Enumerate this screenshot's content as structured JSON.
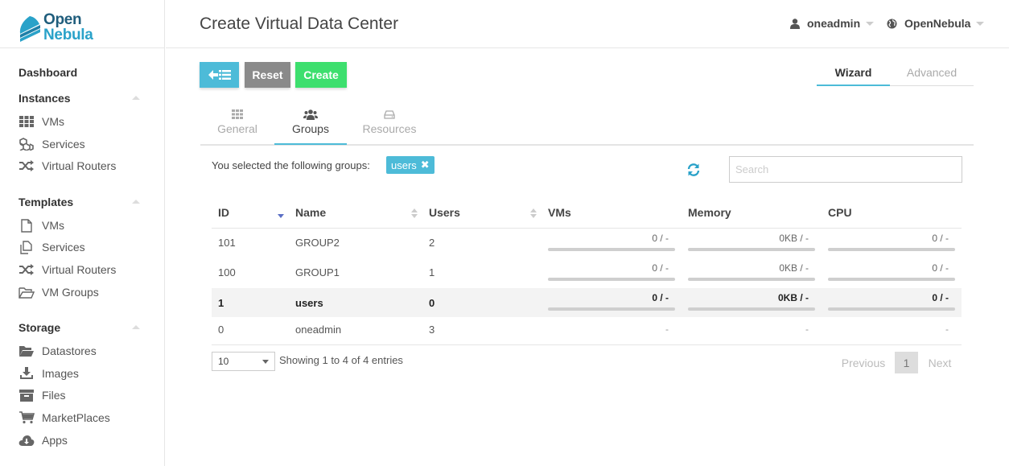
{
  "brand": {
    "line1": "Open",
    "line2": "Nebula"
  },
  "sidebar": {
    "dashboard": "Dashboard",
    "instances": {
      "title": "Instances",
      "items": [
        {
          "label": "VMs",
          "icon": "th-icon"
        },
        {
          "label": "Services",
          "icon": "cubes-icon"
        },
        {
          "label": "Virtual Routers",
          "icon": "random-icon"
        }
      ]
    },
    "templates": {
      "title": "Templates",
      "items": [
        {
          "label": "VMs",
          "icon": "file-icon"
        },
        {
          "label": "Services",
          "icon": "files-icon"
        },
        {
          "label": "Virtual Routers",
          "icon": "random-icon"
        },
        {
          "label": "VM Groups",
          "icon": "folder-open-icon"
        }
      ]
    },
    "storage": {
      "title": "Storage",
      "items": [
        {
          "label": "Datastores",
          "icon": "folder-open-icon"
        },
        {
          "label": "Images",
          "icon": "download-icon"
        },
        {
          "label": "Files",
          "icon": "archive-icon"
        },
        {
          "label": "MarketPlaces",
          "icon": "shopping-cart-icon"
        },
        {
          "label": "Apps",
          "icon": "cloud-download-icon"
        }
      ]
    }
  },
  "header": {
    "title": "Create Virtual Data Center",
    "user": "oneadmin",
    "zone": "OpenNebula"
  },
  "toolbar": {
    "reset_label": "Reset",
    "create_label": "Create"
  },
  "modes": {
    "wizard": "Wizard",
    "advanced": "Advanced"
  },
  "wizard_tabs": {
    "general": "General",
    "groups": "Groups",
    "resources": "Resources"
  },
  "groups": {
    "selected_text": "You selected the following groups:",
    "selected_tag": "users",
    "search_placeholder": "Search",
    "columns": {
      "id": "ID",
      "name": "Name",
      "users": "Users",
      "vms": "VMs",
      "memory": "Memory",
      "cpu": "CPU"
    },
    "rows": [
      {
        "id": "101",
        "name": "GROUP2",
        "users": "2",
        "vms": "0 / -",
        "memory": "0KB / -",
        "cpu": "0 / -"
      },
      {
        "id": "100",
        "name": "GROUP1",
        "users": "1",
        "vms": "0 / -",
        "memory": "0KB / -",
        "cpu": "0 / -"
      },
      {
        "id": "1",
        "name": "users",
        "users": "0",
        "vms": "0 / -",
        "memory": "0KB / -",
        "cpu": "0 / -"
      },
      {
        "id": "0",
        "name": "oneadmin",
        "users": "3",
        "vms": "-",
        "memory": "-",
        "cpu": "-"
      }
    ],
    "page_length": "10",
    "info": "Showing 1 to 4 of 4 entries",
    "pagination": {
      "previous": "Previous",
      "current": "1",
      "next": "Next"
    }
  },
  "colors": {
    "accent": "#4dbbd8",
    "create": "#3ddf6e",
    "reset": "#8a8a8a"
  }
}
